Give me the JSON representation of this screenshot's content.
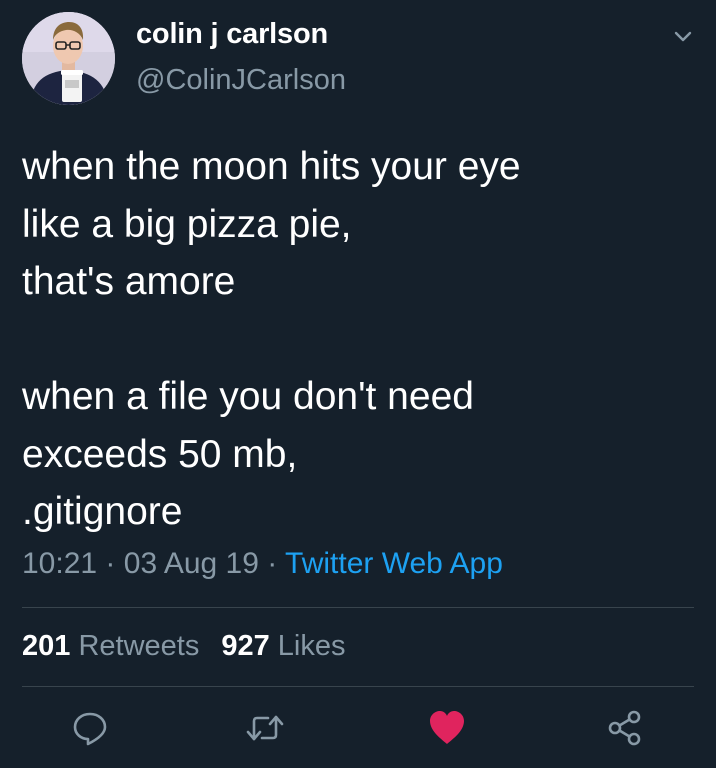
{
  "author": {
    "display_name": "colin j carlson",
    "handle": "@ColinJCarlson"
  },
  "tweet": {
    "lines": [
      "when the moon hits your eye",
      "like a big pizza pie,",
      "that's amore",
      "",
      "when a file you don't need",
      "exceeds 50 mb,",
      ".gitignore"
    ],
    "time": "10:21",
    "separator": "·",
    "date": "03 Aug 19",
    "source": "Twitter Web App"
  },
  "stats": {
    "retweets_count": "201",
    "retweets_label": "Retweets",
    "likes_count": "927",
    "likes_label": "Likes"
  },
  "actions": {
    "reply_icon": "reply-icon",
    "retweet_icon": "retweet-icon",
    "like_icon": "heart-icon",
    "like_state": "liked",
    "share_icon": "share-icon"
  },
  "colors": {
    "background": "#15202b",
    "secondary_text": "#8899a6",
    "link": "#1da1f2",
    "like": "#e0245e",
    "divider": "#38444d"
  }
}
